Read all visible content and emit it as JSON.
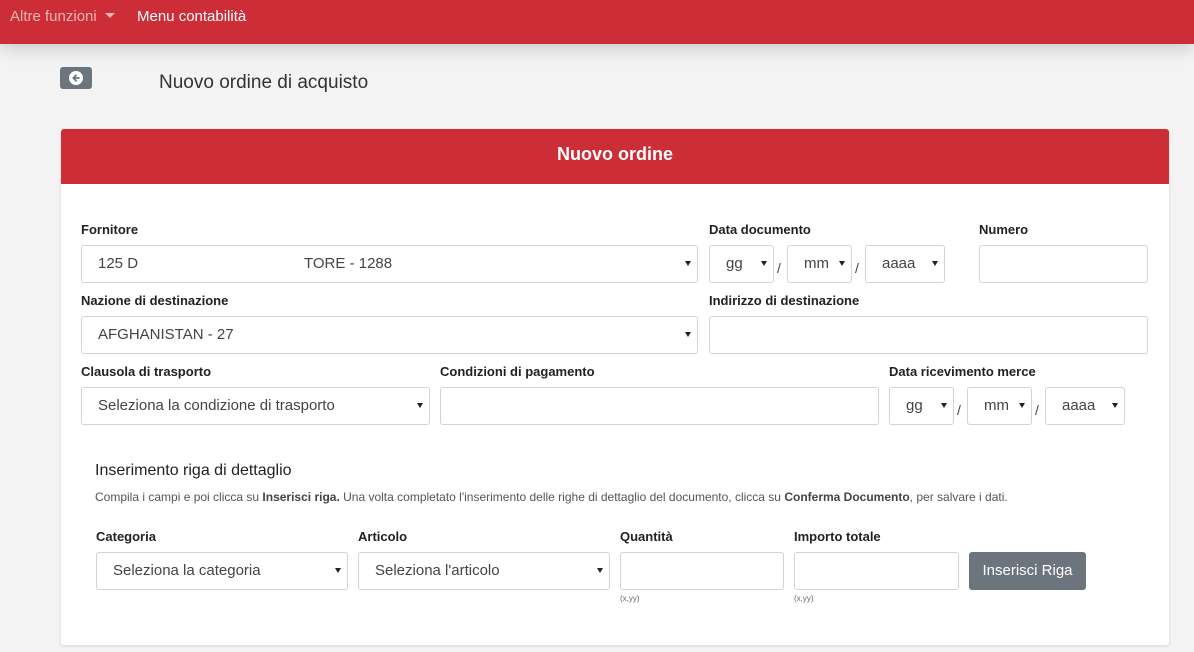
{
  "nav": {
    "altre_funzioni": "Altre funzioni",
    "menu_contabilita": "Menu contabilità"
  },
  "page": {
    "title": "Nuovo ordine di acquisto"
  },
  "card": {
    "header": "Nuovo ordine"
  },
  "form": {
    "fornitore": {
      "label": "Fornitore",
      "value_start": "125 D",
      "value_end": "TORE - 1288"
    },
    "data_documento": {
      "label": "Data documento",
      "gg": "gg",
      "mm": "mm",
      "aaaa": "aaaa"
    },
    "numero": {
      "label": "Numero",
      "value": ""
    },
    "nazione": {
      "label": "Nazione di destinazione",
      "value": "AFGHANISTAN - 27"
    },
    "indirizzo": {
      "label": "Indirizzo di destinazione",
      "value": ""
    },
    "clausola": {
      "label": "Clausola di trasporto",
      "value": "Seleziona la condizione di trasporto"
    },
    "pagamento": {
      "label": "Condizioni di pagamento",
      "value": ""
    },
    "data_ricevimento": {
      "label": "Data ricevimento merce",
      "gg": "gg",
      "mm": "mm",
      "aaaa": "aaaa"
    },
    "date_separator": "/"
  },
  "detail": {
    "title": "Inserimento riga di dettaglio",
    "hint_1": "Compila i campi e poi clicca su ",
    "hint_b1": "Inserisci riga.",
    "hint_2": " Una volta completato l'inserimento delle righe di dettaglio del documento, clicca su ",
    "hint_b2": "Conferma Documento",
    "hint_3": ", per salvare i dati.",
    "categoria": {
      "label": "Categoria",
      "value": "Seleziona la categoria"
    },
    "articolo": {
      "label": "Articolo",
      "value": "Seleziona l'articolo"
    },
    "quantita": {
      "label": "Quantità",
      "value": "",
      "format_hint": "(x,yy)"
    },
    "importo": {
      "label": "Importo totale",
      "value": "",
      "format_hint": "(x,yy)"
    },
    "insert_button": "Inserisci Riga"
  },
  "colors": {
    "brand_red": "#cc2d36",
    "button_gray": "#6c757d"
  },
  "icons": {
    "back": "arrow-circle-left-icon",
    "dropdown": "caret-down-icon"
  }
}
